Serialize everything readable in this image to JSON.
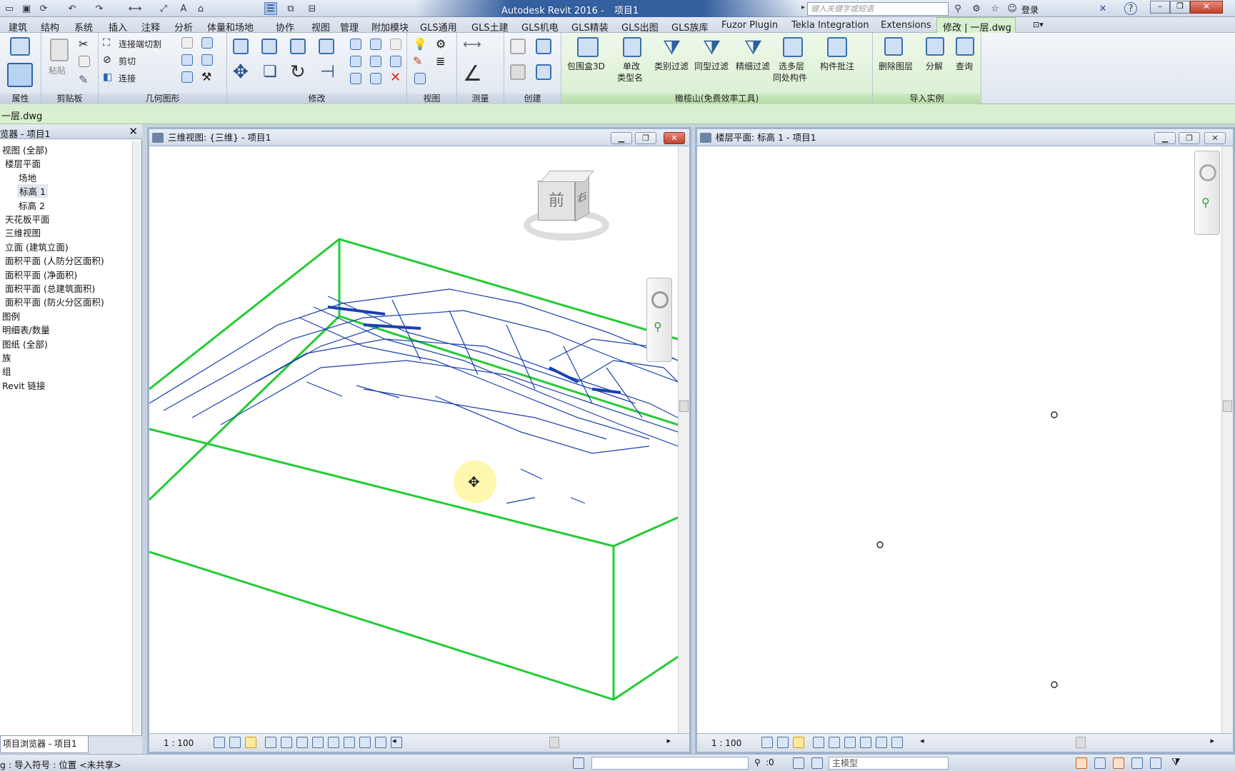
{
  "app": {
    "title": "Autodesk Revit 2016 -",
    "project": "项目1"
  },
  "search": {
    "placeholder": "键入关键字或短语"
  },
  "login": "登录",
  "tabs": [
    "建筑",
    "结构",
    "系统",
    "插入",
    "注释",
    "分析",
    "体量和场地",
    "协作",
    "视图",
    "管理",
    "附加模块",
    "GLS通用",
    "GLS土建",
    "GLS机电",
    "GLS精装",
    "GLS出图",
    "GLS族库",
    "Fuzor Plugin",
    "Tekla Integration",
    "Extensions"
  ],
  "active_tab": "修改 | 一层.dwg",
  "ribbon": {
    "panels": [
      "属性",
      "剪贴板",
      "几何图形",
      "修改",
      "视图",
      "测量",
      "创建",
      "橄榄山(免费效率工具)",
      "导入实例"
    ],
    "paste": "粘贴",
    "geometry": [
      "连接端切割",
      "剪切",
      "连接"
    ],
    "olive": [
      "包围盒3D",
      "单改",
      "类型名",
      "类别过滤",
      "同型过滤",
      "精细过滤",
      "选多层",
      "同处构件",
      "构件批注"
    ],
    "import": [
      "删除图层",
      "分解",
      "查询"
    ]
  },
  "options_bar": {
    "label": "一层.dwg"
  },
  "browser": {
    "title": "览器 - 项目1",
    "items": [
      {
        "label": "视图 (全部)",
        "indent": 0
      },
      {
        "label": "楼层平面",
        "indent": 1
      },
      {
        "label": "场地",
        "indent": 2
      },
      {
        "label": "标高 1",
        "indent": 2,
        "selected": true
      },
      {
        "label": "标高 2",
        "indent": 2
      },
      {
        "label": "天花板平面",
        "indent": 1
      },
      {
        "label": "三维视图",
        "indent": 1
      },
      {
        "label": "立面 (建筑立面)",
        "indent": 1
      },
      {
        "label": "面积平面 (人防分区面积)",
        "indent": 1
      },
      {
        "label": "面积平面 (净面积)",
        "indent": 1
      },
      {
        "label": "面积平面 (总建筑面积)",
        "indent": 1
      },
      {
        "label": "面积平面 (防火分区面积)",
        "indent": 1
      },
      {
        "label": "图例",
        "indent": 0
      },
      {
        "label": "明细表/数量",
        "indent": 0
      },
      {
        "label": "图纸 (全部)",
        "indent": 0
      },
      {
        "label": "族",
        "indent": 0
      },
      {
        "label": "组",
        "indent": 0
      },
      {
        "label": "Revit 链接",
        "indent": 0
      }
    ],
    "footer_tab": "项目浏览器 - 项目1"
  },
  "view3d": {
    "title": "三维视图: {三维} - 项目1",
    "scale": "1 : 100",
    "cube_front": "前",
    "cube_right": "右"
  },
  "viewplan": {
    "title": "楼层平面: 标高 1 - 项目1",
    "scale": "1 : 100"
  },
  "status": {
    "text": "g : 导入符号 : 位置 <未共享>",
    "zero": ":0",
    "model": "主模型"
  },
  "colors": {
    "accent_green": "#22cc33",
    "drawing_blue": "#1a3fb0",
    "active_tab": "#d8f0cf"
  }
}
